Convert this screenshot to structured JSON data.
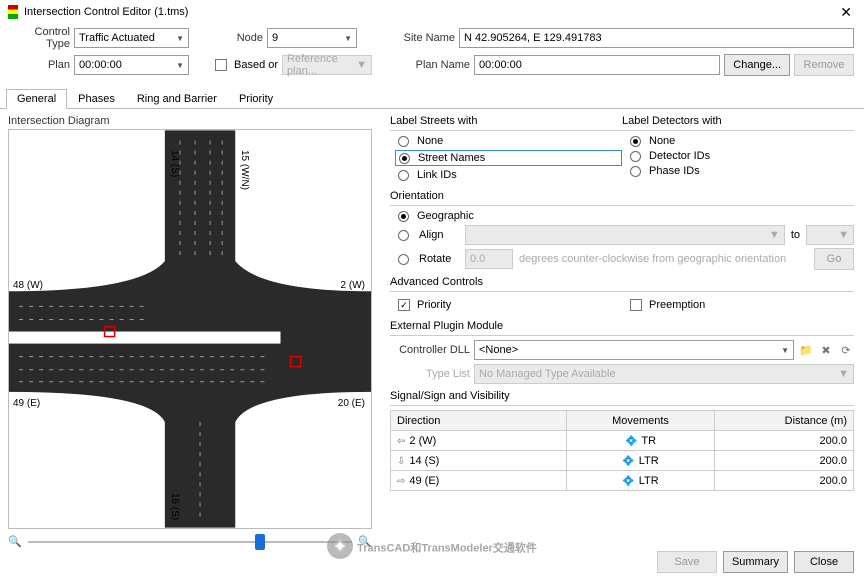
{
  "window": {
    "title": "Intersection Control Editor (1.tms)"
  },
  "form": {
    "control_type_label": "Control Type",
    "control_type_value": "Traffic Actuated",
    "node_label": "Node",
    "node_value": "9",
    "based_or_label": "Based or",
    "reference_plan_placeholder": "Reference plan...",
    "plan_label": "Plan",
    "plan_value": "00:00:00",
    "site_name_label": "Site Name",
    "site_name_value": "N 42.905264, E 129.491783",
    "plan_name_label": "Plan Name",
    "plan_name_value": "00:00:00",
    "change_btn": "Change...",
    "remove_btn": "Remove"
  },
  "tabs": {
    "general": "General",
    "phases": "Phases",
    "ring": "Ring and Barrier",
    "priority": "Priority"
  },
  "diagram": {
    "title": "Intersection Diagram",
    "labels": {
      "n1": "14 (S)",
      "n2": "15 (W/N)",
      "w": "48 (W)",
      "e": "2 (W)",
      "sw": "49 (E)",
      "se": "20 (E)",
      "s": "16 (S)"
    }
  },
  "label_streets": {
    "title": "Label Streets with",
    "none": "None",
    "street_names": "Street Names",
    "link_ids": "Link IDs"
  },
  "label_detectors": {
    "title": "Label Detectors with",
    "none": "None",
    "detector_ids": "Detector IDs",
    "phase_ids": "Phase IDs"
  },
  "orientation": {
    "title": "Orientation",
    "geographic": "Geographic",
    "align": "Align",
    "rotate": "Rotate",
    "to": "to",
    "deg_value": "0.0",
    "deg_hint": "degrees counter-clockwise from geographic orientation",
    "go": "Go"
  },
  "advanced": {
    "title": "Advanced Controls",
    "priority": "Priority",
    "preemption": "Preemption"
  },
  "plugin": {
    "title": "External Plugin Module",
    "controller_dll": "Controller DLL",
    "dll_value": "<None>",
    "type_list": "Type List",
    "type_value": "No Managed Type Available"
  },
  "signal": {
    "title": "Signal/Sign and Visibility",
    "cols": {
      "direction": "Direction",
      "movements": "Movements",
      "distance": "Distance (m)"
    },
    "rows": [
      {
        "dir": "2 (W)",
        "mov": "TR",
        "dist": "200.0",
        "icon": "⇦"
      },
      {
        "dir": "14 (S)",
        "mov": "LTR",
        "dist": "200.0",
        "icon": "⇩"
      },
      {
        "dir": "49 (E)",
        "mov": "LTR",
        "dist": "200.0",
        "icon": "⇨"
      }
    ]
  },
  "footer": {
    "save": "Save",
    "summary": "Summary",
    "close": "Close"
  },
  "watermark": "TransCAD和TransModeler交通软件"
}
